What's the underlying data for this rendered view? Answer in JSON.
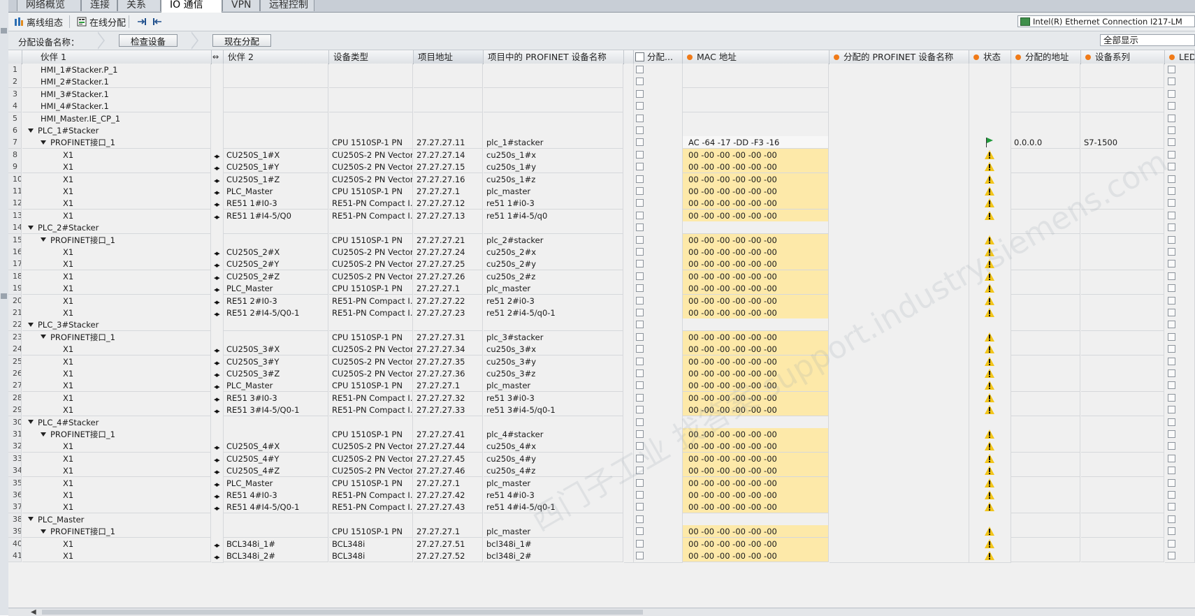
{
  "tabs": [
    "网络概览",
    "连接",
    "关系",
    "IO 通信",
    "VPN",
    "远程控制"
  ],
  "active_tab": 3,
  "toolbar": {
    "offline_label": "离线组态",
    "online_label": "在线分配",
    "network_adapter": "Intel(R) Ethernet Connection I217-LM"
  },
  "assign_bar": {
    "label": "分配设备名称：",
    "check_button": "检查设备",
    "assign_button": "现在分配",
    "filter_value": "全部显示"
  },
  "columns": {
    "partner1": "伙伴 1",
    "partner2": "伙伴 2",
    "device_type": "设备类型",
    "project_address": "项目地址",
    "profinet_name": "项目中的 PROFINET 设备名称",
    "assign": "分配...",
    "mac": "MAC 地址",
    "assigned_name": "分配的 PROFINET 设备名称",
    "status": "状态",
    "assigned_address": "分配的地址",
    "device_family": "设备系列",
    "led": "LED 闪"
  },
  "watermark": "西门子工业 找答案 support.industry.siemens.com",
  "rows": [
    {
      "n": "1",
      "level": 1,
      "expand": false,
      "p1": "HMI_1#Stacker.P_1",
      "link": false,
      "p2": "",
      "type": "",
      "addr": "",
      "pname": "",
      "mac": "",
      "status": "none",
      "aaddr": "",
      "family": ""
    },
    {
      "n": "2",
      "level": 1,
      "expand": false,
      "p1": "HMI_2#Stacker.1",
      "link": false,
      "p2": "",
      "type": "",
      "addr": "",
      "pname": "",
      "mac": "",
      "status": "none",
      "aaddr": "",
      "family": ""
    },
    {
      "n": "3",
      "level": 1,
      "expand": false,
      "p1": "HMI_3#Stacker.1",
      "link": false,
      "p2": "",
      "type": "",
      "addr": "",
      "pname": "",
      "mac": "",
      "status": "none",
      "aaddr": "",
      "family": ""
    },
    {
      "n": "4",
      "level": 1,
      "expand": false,
      "p1": "HMI_4#Stacker.1",
      "link": false,
      "p2": "",
      "type": "",
      "addr": "",
      "pname": "",
      "mac": "",
      "status": "none",
      "aaddr": "",
      "family": ""
    },
    {
      "n": "5",
      "level": 1,
      "expand": false,
      "p1": "HMI_Master.IE_CP_1",
      "link": false,
      "p2": "",
      "type": "",
      "addr": "",
      "pname": "",
      "mac": "",
      "status": "none",
      "aaddr": "",
      "family": ""
    },
    {
      "n": "6",
      "level": 0,
      "expand": true,
      "p1": "PLC_1#Stacker",
      "link": false,
      "p2": "",
      "type": "",
      "addr": "",
      "pname": "",
      "mac": "",
      "status": "none",
      "aaddr": "",
      "family": ""
    },
    {
      "n": "7",
      "level": 1,
      "expand": true,
      "p1": "PROFINET接口_1",
      "link": false,
      "p2": "",
      "type": "CPU 1510SP-1 PN",
      "addr": "27.27.27.11",
      "pname": "plc_1#stacker",
      "mac": "AC -64 -17 -DD -F3 -16",
      "macstyle": "w",
      "status": "flag",
      "aaddr": "0.0.0.0",
      "family": "S7-1500"
    },
    {
      "n": "8",
      "level": 2,
      "expand": false,
      "p1": "X1",
      "link": true,
      "p2": "CU250S_1#X",
      "type": "CU250S-2 PN Vector",
      "addr": "27.27.27.14",
      "pname": "cu250s_1#x",
      "mac": "00 -00 -00 -00 -00 -00",
      "macstyle": "y",
      "status": "warn",
      "aaddr": "",
      "family": ""
    },
    {
      "n": "9",
      "level": 2,
      "expand": false,
      "p1": "X1",
      "link": true,
      "p2": "CU250S_1#Y",
      "type": "CU250S-2 PN Vector",
      "addr": "27.27.27.15",
      "pname": "cu250s_1#y",
      "mac": "00 -00 -00 -00 -00 -00",
      "macstyle": "y",
      "status": "warn",
      "aaddr": "",
      "family": ""
    },
    {
      "n": "10",
      "level": 2,
      "expand": false,
      "p1": "X1",
      "link": true,
      "p2": "CU250S_1#Z",
      "type": "CU250S-2 PN Vector",
      "addr": "27.27.27.16",
      "pname": "cu250s_1#z",
      "mac": "00 -00 -00 -00 -00 -00",
      "macstyle": "y",
      "status": "warn",
      "aaddr": "",
      "family": ""
    },
    {
      "n": "11",
      "level": 2,
      "expand": false,
      "p1": "X1",
      "link": true,
      "p2": "PLC_Master",
      "type": "CPU 1510SP-1 PN",
      "addr": "27.27.27.1",
      "pname": "plc_master",
      "mac": "00 -00 -00 -00 -00 -00",
      "macstyle": "y",
      "status": "warn",
      "aaddr": "",
      "family": ""
    },
    {
      "n": "12",
      "level": 2,
      "expand": false,
      "p1": "X1",
      "link": true,
      "p2": "RE51 1#I0-3",
      "type": "RE51-PN Compact I...",
      "addr": "27.27.27.12",
      "pname": "re51 1#i0-3",
      "mac": "00 -00 -00 -00 -00 -00",
      "macstyle": "y",
      "status": "warn",
      "aaddr": "",
      "family": ""
    },
    {
      "n": "13",
      "level": 2,
      "expand": false,
      "p1": "X1",
      "link": true,
      "p2": "RE51 1#I4-5/Q0",
      "type": "RE51-PN Compact I...",
      "addr": "27.27.27.13",
      "pname": "re51 1#i4-5/q0",
      "mac": "00 -00 -00 -00 -00 -00",
      "macstyle": "y",
      "status": "warn",
      "aaddr": "",
      "family": ""
    },
    {
      "n": "14",
      "level": 0,
      "expand": true,
      "p1": "PLC_2#Stacker",
      "link": false,
      "p2": "",
      "type": "",
      "addr": "",
      "pname": "",
      "mac": "",
      "status": "none",
      "aaddr": "",
      "family": ""
    },
    {
      "n": "15",
      "level": 1,
      "expand": true,
      "p1": "PROFINET接口_1",
      "link": false,
      "p2": "",
      "type": "CPU 1510SP-1 PN",
      "addr": "27.27.27.21",
      "pname": "plc_2#stacker",
      "mac": "00 -00 -00 -00 -00 -00",
      "macstyle": "y",
      "status": "warn",
      "aaddr": "",
      "family": ""
    },
    {
      "n": "16",
      "level": 2,
      "expand": false,
      "p1": "X1",
      "link": true,
      "p2": "CU250S_2#X",
      "type": "CU250S-2 PN Vector",
      "addr": "27.27.27.24",
      "pname": "cu250s_2#x",
      "mac": "00 -00 -00 -00 -00 -00",
      "macstyle": "y",
      "status": "warn",
      "aaddr": "",
      "family": ""
    },
    {
      "n": "17",
      "level": 2,
      "expand": false,
      "p1": "X1",
      "link": true,
      "p2": "CU250S_2#Y",
      "type": "CU250S-2 PN Vector",
      "addr": "27.27.27.25",
      "pname": "cu250s_2#y",
      "mac": "00 -00 -00 -00 -00 -00",
      "macstyle": "y",
      "status": "warn",
      "aaddr": "",
      "family": ""
    },
    {
      "n": "18",
      "level": 2,
      "expand": false,
      "p1": "X1",
      "link": true,
      "p2": "CU250S_2#Z",
      "type": "CU250S-2 PN Vector",
      "addr": "27.27.27.26",
      "pname": "cu250s_2#z",
      "mac": "00 -00 -00 -00 -00 -00",
      "macstyle": "y",
      "status": "warn",
      "aaddr": "",
      "family": ""
    },
    {
      "n": "19",
      "level": 2,
      "expand": false,
      "p1": "X1",
      "link": true,
      "p2": "PLC_Master",
      "type": "CPU 1510SP-1 PN",
      "addr": "27.27.27.1",
      "pname": "plc_master",
      "mac": "00 -00 -00 -00 -00 -00",
      "macstyle": "y",
      "status": "warn",
      "aaddr": "",
      "family": ""
    },
    {
      "n": "20",
      "level": 2,
      "expand": false,
      "p1": "X1",
      "link": true,
      "p2": "RE51 2#I0-3",
      "type": "RE51-PN Compact I...",
      "addr": "27.27.27.22",
      "pname": "re51 2#i0-3",
      "mac": "00 -00 -00 -00 -00 -00",
      "macstyle": "y",
      "status": "warn",
      "aaddr": "",
      "family": ""
    },
    {
      "n": "21",
      "level": 2,
      "expand": false,
      "p1": "X1",
      "link": true,
      "p2": "RE51 2#I4-5/Q0-1",
      "type": "RE51-PN Compact I...",
      "addr": "27.27.27.23",
      "pname": "re51 2#i4-5/q0-1",
      "mac": "00 -00 -00 -00 -00 -00",
      "macstyle": "y",
      "status": "warn",
      "aaddr": "",
      "family": ""
    },
    {
      "n": "22",
      "level": 0,
      "expand": true,
      "p1": "PLC_3#Stacker",
      "link": false,
      "p2": "",
      "type": "",
      "addr": "",
      "pname": "",
      "mac": "",
      "status": "none",
      "aaddr": "",
      "family": ""
    },
    {
      "n": "23",
      "level": 1,
      "expand": true,
      "p1": "PROFINET接口_1",
      "link": false,
      "p2": "",
      "type": "CPU 1510SP-1 PN",
      "addr": "27.27.27.31",
      "pname": "plc_3#stacker",
      "mac": "00 -00 -00 -00 -00 -00",
      "macstyle": "y",
      "status": "warn",
      "aaddr": "",
      "family": ""
    },
    {
      "n": "24",
      "level": 2,
      "expand": false,
      "p1": "X1",
      "link": true,
      "p2": "CU250S_3#X",
      "type": "CU250S-2 PN Vector",
      "addr": "27.27.27.34",
      "pname": "cu250s_3#x",
      "mac": "00 -00 -00 -00 -00 -00",
      "macstyle": "y",
      "status": "warn",
      "aaddr": "",
      "family": ""
    },
    {
      "n": "25",
      "level": 2,
      "expand": false,
      "p1": "X1",
      "link": true,
      "p2": "CU250S_3#Y",
      "type": "CU250S-2 PN Vector",
      "addr": "27.27.27.35",
      "pname": "cu250s_3#y",
      "mac": "00 -00 -00 -00 -00 -00",
      "macstyle": "y",
      "status": "warn",
      "aaddr": "",
      "family": ""
    },
    {
      "n": "26",
      "level": 2,
      "expand": false,
      "p1": "X1",
      "link": true,
      "p2": "CU250S_3#Z",
      "type": "CU250S-2 PN Vector",
      "addr": "27.27.27.36",
      "pname": "cu250s_3#z",
      "mac": "00 -00 -00 -00 -00 -00",
      "macstyle": "y",
      "status": "warn",
      "aaddr": "",
      "family": ""
    },
    {
      "n": "27",
      "level": 2,
      "expand": false,
      "p1": "X1",
      "link": true,
      "p2": "PLC_Master",
      "type": "CPU 1510SP-1 PN",
      "addr": "27.27.27.1",
      "pname": "plc_master",
      "mac": "00 -00 -00 -00 -00 -00",
      "macstyle": "y",
      "status": "warn",
      "aaddr": "",
      "family": ""
    },
    {
      "n": "28",
      "level": 2,
      "expand": false,
      "p1": "X1",
      "link": true,
      "p2": "RE51 3#I0-3",
      "type": "RE51-PN Compact I...",
      "addr": "27.27.27.32",
      "pname": "re51 3#i0-3",
      "mac": "00 -00 -00 -00 -00 -00",
      "macstyle": "y",
      "status": "warn",
      "aaddr": "",
      "family": ""
    },
    {
      "n": "29",
      "level": 2,
      "expand": false,
      "p1": "X1",
      "link": true,
      "p2": "RE51 3#I4-5/Q0-1",
      "type": "RE51-PN Compact I...",
      "addr": "27.27.27.33",
      "pname": "re51 3#i4-5/q0-1",
      "mac": "00 -00 -00 -00 -00 -00",
      "macstyle": "y",
      "status": "warn",
      "aaddr": "",
      "family": ""
    },
    {
      "n": "30",
      "level": 0,
      "expand": true,
      "p1": "PLC_4#Stacker",
      "link": false,
      "p2": "",
      "type": "",
      "addr": "",
      "pname": "",
      "mac": "",
      "status": "none",
      "aaddr": "",
      "family": ""
    },
    {
      "n": "31",
      "level": 1,
      "expand": true,
      "p1": "PROFINET接口_1",
      "link": false,
      "p2": "",
      "type": "CPU 1510SP-1 PN",
      "addr": "27.27.27.41",
      "pname": "plc_4#stacker",
      "mac": "00 -00 -00 -00 -00 -00",
      "macstyle": "y",
      "status": "warn",
      "aaddr": "",
      "family": ""
    },
    {
      "n": "32",
      "level": 2,
      "expand": false,
      "p1": "X1",
      "link": true,
      "p2": "CU250S_4#X",
      "type": "CU250S-2 PN Vector",
      "addr": "27.27.27.44",
      "pname": "cu250s_4#x",
      "mac": "00 -00 -00 -00 -00 -00",
      "macstyle": "y",
      "status": "warn",
      "aaddr": "",
      "family": ""
    },
    {
      "n": "33",
      "level": 2,
      "expand": false,
      "p1": "X1",
      "link": true,
      "p2": "CU250S_4#Y",
      "type": "CU250S-2 PN Vector",
      "addr": "27.27.27.45",
      "pname": "cu250s_4#y",
      "mac": "00 -00 -00 -00 -00 -00",
      "macstyle": "y",
      "status": "warn",
      "aaddr": "",
      "family": ""
    },
    {
      "n": "34",
      "level": 2,
      "expand": false,
      "p1": "X1",
      "link": true,
      "p2": "CU250S_4#Z",
      "type": "CU250S-2 PN Vector",
      "addr": "27.27.27.46",
      "pname": "cu250s_4#z",
      "mac": "00 -00 -00 -00 -00 -00",
      "macstyle": "y",
      "status": "warn",
      "aaddr": "",
      "family": ""
    },
    {
      "n": "35",
      "level": 2,
      "expand": false,
      "p1": "X1",
      "link": true,
      "p2": "PLC_Master",
      "type": "CPU 1510SP-1 PN",
      "addr": "27.27.27.1",
      "pname": "plc_master",
      "mac": "00 -00 -00 -00 -00 -00",
      "macstyle": "y",
      "status": "warn",
      "aaddr": "",
      "family": ""
    },
    {
      "n": "36",
      "level": 2,
      "expand": false,
      "p1": "X1",
      "link": true,
      "p2": "RE51 4#I0-3",
      "type": "RE51-PN Compact I...",
      "addr": "27.27.27.42",
      "pname": "re51 4#i0-3",
      "mac": "00 -00 -00 -00 -00 -00",
      "macstyle": "y",
      "status": "warn",
      "aaddr": "",
      "family": ""
    },
    {
      "n": "37",
      "level": 2,
      "expand": false,
      "p1": "X1",
      "link": true,
      "p2": "RE51 4#I4-5/Q0-1",
      "type": "RE51-PN Compact I...",
      "addr": "27.27.27.43",
      "pname": "re51 4#i4-5/q0-1",
      "mac": "00 -00 -00 -00 -00 -00",
      "macstyle": "y",
      "status": "warn",
      "aaddr": "",
      "family": ""
    },
    {
      "n": "38",
      "level": 0,
      "expand": true,
      "p1": "PLC_Master",
      "link": false,
      "p2": "",
      "type": "",
      "addr": "",
      "pname": "",
      "mac": "",
      "status": "none",
      "aaddr": "",
      "family": ""
    },
    {
      "n": "39",
      "level": 1,
      "expand": true,
      "p1": "PROFINET接口_1",
      "link": false,
      "p2": "",
      "type": "CPU 1510SP-1 PN",
      "addr": "27.27.27.1",
      "pname": "plc_master",
      "mac": "00 -00 -00 -00 -00 -00",
      "macstyle": "y",
      "status": "warn",
      "aaddr": "",
      "family": ""
    },
    {
      "n": "40",
      "level": 2,
      "expand": false,
      "p1": "X1",
      "link": true,
      "p2": "BCL348i_1#",
      "type": "BCL348i",
      "addr": "27.27.27.51",
      "pname": "bcl348i_1#",
      "mac": "00 -00 -00 -00 -00 -00",
      "macstyle": "y",
      "status": "warn",
      "aaddr": "",
      "family": ""
    },
    {
      "n": "41",
      "level": 2,
      "expand": false,
      "p1": "X1",
      "link": true,
      "p2": "BCL348i_2#",
      "type": "BCL348i",
      "addr": "27.27.27.52",
      "pname": "bcl348i_2#",
      "mac": "00 -00 -00 -00 -00 -00",
      "macstyle": "y",
      "status": "warn",
      "aaddr": "",
      "family": ""
    }
  ]
}
